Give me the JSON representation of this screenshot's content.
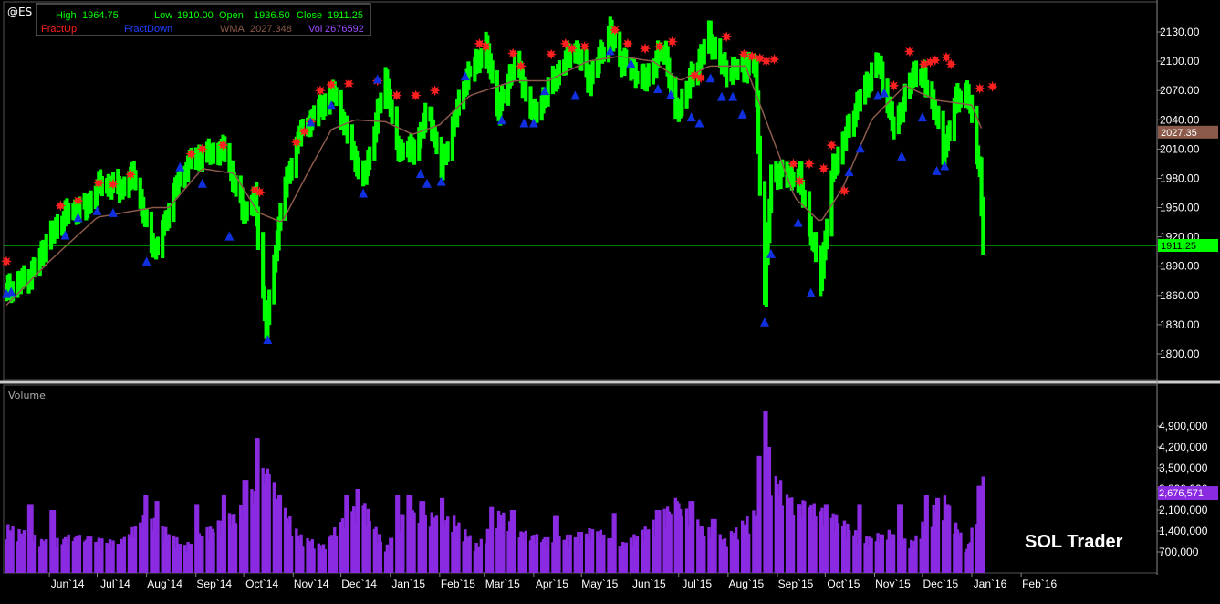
{
  "symbol": "@ES",
  "header": {
    "high_label": "High",
    "high": "1964.75",
    "low_label": "Low",
    "low": "1910.00",
    "open_label": "Open",
    "open": "1936.50",
    "close_label": "Close",
    "close": "1911.25",
    "fract_up_label": "FractUp",
    "fract_down_label": "FractDown",
    "wma_label": "WMA",
    "wma": "2027.348",
    "vol_label": "Vol",
    "vol": "2676592"
  },
  "colors": {
    "background": "#000000",
    "price_bar": "#00ff00",
    "wma_line": "#8b5a4a",
    "fract_up": "#ff2020",
    "fract_down": "#1030e0",
    "volume_bar": "#8a2be2",
    "axis_text": "#ffffff",
    "close_line": "#00ff00"
  },
  "price_axis_labels": [
    "2130.00",
    "2100.00",
    "2070.00",
    "2040.00",
    "2010.00",
    "1980.00",
    "1950.00",
    "1920.00",
    "1890.00",
    "1860.00",
    "1830.00",
    "1800.00"
  ],
  "price_badges": {
    "wma": "2027.35",
    "close": "1911.25"
  },
  "volume_panel": {
    "title": "Volume",
    "axis_labels": [
      "4,900,000",
      "4,200,000",
      "3,500,000",
      "2,800,000",
      "2,100,000",
      "1,400,000",
      "700,000"
    ],
    "badge": "2,676,571"
  },
  "x_axis_labels": [
    "Jun`14",
    "Jul`14",
    "Aug`14",
    "Sep`14",
    "Oct`14",
    "Nov`14",
    "Dec`14",
    "Jan`15",
    "Feb`15",
    "Mar`15",
    "Apr`15",
    "May`15",
    "Jun`15",
    "Jul`15",
    "Aug`15",
    "Sep`15",
    "Oct`15",
    "Nov`15",
    "Dec`15",
    "Jan`16",
    "Feb`16"
  ],
  "watermark": "SOL Trader",
  "chart_data": {
    "type": "ohlc",
    "title": "@ES",
    "ylim": [
      1785,
      2145
    ],
    "volume_ylim": [
      0,
      5400000
    ],
    "price_path": [
      [
        "2014-05-05",
        1865
      ],
      [
        "2014-05-20",
        1880
      ],
      [
        "2014-06-01",
        1920
      ],
      [
        "2014-06-12",
        1945
      ],
      [
        "2014-06-24",
        1950
      ],
      [
        "2014-07-03",
        1975
      ],
      [
        "2014-07-17",
        1970
      ],
      [
        "2014-07-24",
        1985
      ],
      [
        "2014-08-01",
        1930
      ],
      [
        "2014-08-07",
        1905
      ],
      [
        "2014-08-19",
        1970
      ],
      [
        "2014-08-29",
        2000
      ],
      [
        "2014-09-19",
        2010
      ],
      [
        "2014-09-25",
        1975
      ],
      [
        "2014-10-01",
        1945
      ],
      [
        "2014-10-08",
        1960
      ],
      [
        "2014-10-15",
        1825
      ],
      [
        "2014-10-25",
        1960
      ],
      [
        "2014-11-05",
        2025
      ],
      [
        "2014-11-26",
        2070
      ],
      [
        "2014-12-15",
        1975
      ],
      [
        "2014-12-29",
        2085
      ],
      [
        "2015-01-05",
        2010
      ],
      [
        "2015-01-16",
        2010
      ],
      [
        "2015-01-25",
        2050
      ],
      [
        "2015-02-02",
        1990
      ],
      [
        "2015-02-17",
        2080
      ],
      [
        "2015-03-02",
        2115
      ],
      [
        "2015-03-10",
        2050
      ],
      [
        "2015-03-20",
        2100
      ],
      [
        "2015-04-01",
        2045
      ],
      [
        "2015-04-26",
        2115
      ],
      [
        "2015-05-06",
        2080
      ],
      [
        "2015-05-19",
        2130
      ],
      [
        "2015-05-26",
        2100
      ],
      [
        "2015-06-10",
        2080
      ],
      [
        "2015-06-22",
        2115
      ],
      [
        "2015-06-29",
        2045
      ],
      [
        "2015-07-20",
        2125
      ],
      [
        "2015-07-30",
        2090
      ],
      [
        "2015-08-18",
        2095
      ],
      [
        "2015-08-24",
        1860
      ],
      [
        "2015-08-28",
        1985
      ],
      [
        "2015-09-15",
        1980
      ],
      [
        "2015-09-28",
        1875
      ],
      [
        "2015-10-06",
        1990
      ],
      [
        "2015-10-22",
        2060
      ],
      [
        "2015-11-03",
        2100
      ],
      [
        "2015-11-13",
        2030
      ],
      [
        "2015-11-26",
        2090
      ],
      [
        "2015-12-01",
        2085
      ],
      [
        "2015-12-09",
        2050
      ],
      [
        "2015-12-14",
        2005
      ],
      [
        "2015-12-22",
        2060
      ],
      [
        "2015-12-29",
        2070
      ],
      [
        "2016-01-06",
        1990
      ],
      [
        "2016-01-08",
        1911.25
      ]
    ],
    "fractal_up": [
      [
        "2014-05-05",
        1895
      ],
      [
        "2014-06-08",
        1952
      ],
      [
        "2014-06-19",
        1957
      ],
      [
        "2014-07-02",
        1975
      ],
      [
        "2014-07-11",
        1974
      ],
      [
        "2014-07-22",
        1984
      ],
      [
        "2014-08-29",
        2005
      ],
      [
        "2014-09-05",
        2010
      ],
      [
        "2014-09-18",
        2014
      ],
      [
        "2014-10-08",
        1968
      ],
      [
        "2014-10-11",
        1966
      ],
      [
        "2014-11-03",
        2017
      ],
      [
        "2014-11-08",
        2028
      ],
      [
        "2014-11-12",
        2038
      ],
      [
        "2014-11-18",
        2070
      ],
      [
        "2014-11-25",
        2076
      ],
      [
        "2014-12-06",
        2077
      ],
      [
        "2014-12-24",
        2080
      ],
      [
        "2015-01-05",
        2065
      ],
      [
        "2015-01-17",
        2065
      ],
      [
        "2015-01-29",
        2070
      ],
      [
        "2015-02-26",
        2118
      ],
      [
        "2015-03-02",
        2115
      ],
      [
        "2015-03-19",
        2108
      ],
      [
        "2015-03-24",
        2095
      ],
      [
        "2015-04-12",
        2107
      ],
      [
        "2015-04-21",
        2118
      ],
      [
        "2015-04-25",
        2113
      ],
      [
        "2015-05-03",
        2115
      ],
      [
        "2015-05-22",
        2132
      ],
      [
        "2015-05-30",
        2118
      ],
      [
        "2015-06-10",
        2113
      ],
      [
        "2015-06-19",
        2115
      ],
      [
        "2015-06-27",
        2120
      ],
      [
        "2015-07-11",
        2085
      ],
      [
        "2015-07-15",
        2083
      ],
      [
        "2015-07-31",
        2125
      ],
      [
        "2015-08-11",
        2107
      ],
      [
        "2015-08-16",
        2105
      ],
      [
        "2015-08-21",
        2103
      ],
      [
        "2015-08-25",
        2100
      ],
      [
        "2015-08-30",
        2102
      ],
      [
        "2015-09-11",
        1995
      ],
      [
        "2015-09-15",
        1977
      ],
      [
        "2015-09-21",
        1995
      ],
      [
        "2015-09-30",
        1990
      ],
      [
        "2015-10-05",
        2014
      ],
      [
        "2015-10-13",
        1967
      ],
      [
        "2015-11-13",
        2075
      ],
      [
        "2015-11-23",
        2110
      ],
      [
        "2015-12-02",
        2097
      ],
      [
        "2015-12-06",
        2099
      ],
      [
        "2015-12-09",
        2101
      ],
      [
        "2015-12-16",
        2104
      ],
      [
        "2015-12-19",
        2097
      ],
      [
        "2016-01-06",
        2072
      ],
      [
        "2016-01-14",
        2074
      ]
    ],
    "fractal_down": [
      [
        "2014-05-05",
        1862
      ],
      [
        "2014-05-08",
        1864
      ],
      [
        "2014-06-11",
        1922
      ],
      [
        "2014-06-19",
        1940
      ],
      [
        "2014-07-01",
        1947
      ],
      [
        "2014-07-11",
        1945
      ],
      [
        "2014-08-01",
        1895
      ],
      [
        "2014-08-22",
        1992
      ],
      [
        "2014-09-05",
        1975
      ],
      [
        "2014-09-22",
        1921
      ],
      [
        "2014-10-16",
        1815
      ],
      [
        "2014-11-12",
        2038
      ],
      [
        "2014-11-25",
        2055
      ],
      [
        "2014-12-15",
        1965
      ],
      [
        "2014-12-24",
        2082
      ],
      [
        "2015-01-20",
        1985
      ],
      [
        "2015-01-24",
        1975
      ],
      [
        "2015-02-02",
        1977
      ],
      [
        "2015-02-17",
        2085
      ],
      [
        "2015-03-12",
        2040
      ],
      [
        "2015-03-26",
        2037
      ],
      [
        "2015-04-01",
        2037
      ],
      [
        "2015-04-08",
        2070
      ],
      [
        "2015-04-27",
        2065
      ],
      [
        "2015-05-19",
        2111
      ],
      [
        "2015-06-01",
        2098
      ],
      [
        "2015-06-18",
        2072
      ],
      [
        "2015-06-26",
        2066
      ],
      [
        "2015-07-09",
        2043
      ],
      [
        "2015-07-14",
        2037
      ],
      [
        "2015-07-21",
        2083
      ],
      [
        "2015-07-28",
        2064
      ],
      [
        "2015-08-04",
        2064
      ],
      [
        "2015-08-10",
        2046
      ],
      [
        "2015-08-24",
        1833
      ],
      [
        "2015-08-28",
        1903
      ],
      [
        "2015-09-14",
        1935
      ],
      [
        "2015-09-22",
        1863
      ],
      [
        "2015-10-16",
        1987
      ],
      [
        "2015-10-23",
        2011
      ],
      [
        "2015-11-03",
        2065
      ],
      [
        "2015-11-07",
        2068
      ],
      [
        "2015-11-18",
        2003
      ],
      [
        "2015-12-01",
        2043
      ],
      [
        "2015-12-10",
        1988
      ],
      [
        "2015-12-15",
        1993
      ]
    ],
    "wma_path": [
      [
        "2014-05-05",
        1850
      ],
      [
        "2014-06-01",
        1895
      ],
      [
        "2014-07-01",
        1940
      ],
      [
        "2014-08-05",
        1950
      ],
      [
        "2014-08-15",
        1950
      ],
      [
        "2014-09-05",
        1990
      ],
      [
        "2014-09-25",
        1985
      ],
      [
        "2014-10-10",
        1945
      ],
      [
        "2014-10-25",
        1935
      ],
      [
        "2014-11-10",
        1985
      ],
      [
        "2014-11-25",
        2030
      ],
      [
        "2014-12-10",
        2040
      ],
      [
        "2014-12-29",
        2038
      ],
      [
        "2015-01-15",
        2025
      ],
      [
        "2015-02-01",
        2035
      ],
      [
        "2015-02-20",
        2065
      ],
      [
        "2015-03-20",
        2080
      ],
      [
        "2015-04-10",
        2080
      ],
      [
        "2015-05-05",
        2100
      ],
      [
        "2015-05-25",
        2105
      ],
      [
        "2015-06-15",
        2100
      ],
      [
        "2015-07-02",
        2080
      ],
      [
        "2015-07-20",
        2095
      ],
      [
        "2015-08-12",
        2095
      ],
      [
        "2015-08-27",
        2030
      ],
      [
        "2015-09-12",
        1960
      ],
      [
        "2015-09-28",
        1935
      ],
      [
        "2015-10-12",
        1970
      ],
      [
        "2015-10-30",
        2040
      ],
      [
        "2015-11-20",
        2075
      ],
      [
        "2015-12-10",
        2060
      ],
      [
        "2016-01-01",
        2055
      ],
      [
        "2016-01-08",
        2027.35
      ]
    ],
    "volume_path": [
      [
        "2014-05-05",
        1400000
      ],
      [
        "2014-06-01",
        900000
      ],
      [
        "2014-06-15",
        1100000
      ],
      [
        "2014-07-01",
        1000000
      ],
      [
        "2014-07-15",
        900000
      ],
      [
        "2014-08-01",
        1700000
      ],
      [
        "2014-08-10",
        1400000
      ],
      [
        "2014-08-25",
        800000
      ],
      [
        "2014-09-05",
        1200000
      ],
      [
        "2014-09-20",
        1600000
      ],
      [
        "2014-10-02",
        2000000
      ],
      [
        "2014-10-08",
        2500000
      ],
      [
        "2014-10-15",
        3100000
      ],
      [
        "2014-10-25",
        2000000
      ],
      [
        "2014-11-05",
        1100000
      ],
      [
        "2014-11-20",
        800000
      ],
      [
        "2014-12-05",
        1800000
      ],
      [
        "2014-12-15",
        2100000
      ],
      [
        "2014-12-29",
        700000
      ],
      [
        "2015-01-10",
        1900000
      ],
      [
        "2015-01-25",
        1700000
      ],
      [
        "2015-02-10",
        1600000
      ],
      [
        "2015-02-25",
        800000
      ],
      [
        "2015-03-10",
        1800000
      ],
      [
        "2015-03-25",
        1200000
      ],
      [
        "2015-04-10",
        1000000
      ],
      [
        "2015-04-25",
        1100000
      ],
      [
        "2015-05-10",
        1300000
      ],
      [
        "2015-05-25",
        800000
      ],
      [
        "2015-06-10",
        1300000
      ],
      [
        "2015-06-29",
        2100000
      ],
      [
        "2015-07-15",
        1400000
      ],
      [
        "2015-07-30",
        1000000
      ],
      [
        "2015-08-20",
        1900000
      ],
      [
        "2015-08-24",
        3900000
      ],
      [
        "2015-08-28",
        3000000
      ],
      [
        "2015-09-10",
        2100000
      ],
      [
        "2015-09-28",
        1900000
      ],
      [
        "2015-10-10",
        1600000
      ],
      [
        "2015-10-25",
        1000000
      ],
      [
        "2015-11-10",
        1200000
      ],
      [
        "2015-11-25",
        900000
      ],
      [
        "2015-12-05",
        1800000
      ],
      [
        "2015-12-15",
        2200000
      ],
      [
        "2015-12-29",
        700000
      ],
      [
        "2016-01-05",
        2000000
      ],
      [
        "2016-01-08",
        2676571
      ]
    ],
    "volume_spikes": [
      [
        "2014-05-20",
        2300000
      ],
      [
        "2014-06-03",
        2100000
      ],
      [
        "2014-08-01",
        2600000
      ],
      [
        "2014-08-08",
        2400000
      ],
      [
        "2014-09-01",
        2300000
      ],
      [
        "2014-09-19",
        2600000
      ],
      [
        "2014-10-02",
        3100000
      ],
      [
        "2014-10-10",
        4500000
      ],
      [
        "2014-10-16",
        3300000
      ],
      [
        "2014-10-24",
        2600000
      ],
      [
        "2014-12-05",
        2600000
      ],
      [
        "2014-12-12",
        2800000
      ],
      [
        "2015-01-05",
        2600000
      ],
      [
        "2015-01-13",
        2600000
      ],
      [
        "2015-01-21",
        2400000
      ],
      [
        "2015-02-02",
        2500000
      ],
      [
        "2015-03-06",
        2200000
      ],
      [
        "2015-03-19",
        2100000
      ],
      [
        "2015-04-15",
        1900000
      ],
      [
        "2015-05-22",
        2000000
      ],
      [
        "2015-06-18",
        2100000
      ],
      [
        "2015-06-29",
        2400000
      ],
      [
        "2015-07-09",
        2400000
      ],
      [
        "2015-07-23",
        1800000
      ],
      [
        "2015-08-21",
        3900000
      ],
      [
        "2015-08-24",
        5400000
      ],
      [
        "2015-08-26",
        4200000
      ],
      [
        "2015-09-01",
        2400000
      ],
      [
        "2015-09-09",
        2500000
      ],
      [
        "2015-09-18",
        2400000
      ],
      [
        "2015-10-02",
        2300000
      ],
      [
        "2015-10-23",
        2300000
      ],
      [
        "2015-11-17",
        2300000
      ],
      [
        "2015-12-04",
        2600000
      ],
      [
        "2015-12-11",
        2500000
      ],
      [
        "2015-12-16",
        2300000
      ],
      [
        "2016-01-06",
        2900000
      ]
    ]
  }
}
